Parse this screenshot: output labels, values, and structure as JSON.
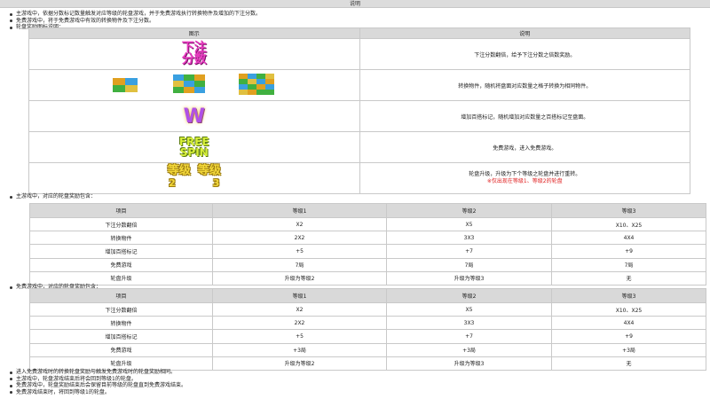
{
  "title": "说明",
  "intro": [
    "主游戏中，依据分数标记数量触发对应等级的轮盘游戏，并于免费游戏执行转换物件及增加的下注分数。",
    "免费游戏中，将于免费游戏中有效的转换物件及下注分数。",
    "轮盘奖励图标说明："
  ],
  "icon_table": {
    "headers": [
      "图示",
      "说明"
    ],
    "rows": [
      {
        "icon_text_1": "下注",
        "icon_text_2": "分数",
        "desc": "下注分数翻倍，给予下注分数之倍数奖励。"
      },
      {
        "desc": "转换物件，随机将盘面对应数量之格子转换为相同物件。"
      },
      {
        "icon_text_1": "W",
        "desc": "增加百搭标记，随机增加对应数量之百搭标记至盘面。"
      },
      {
        "icon_text_1": "FREE",
        "icon_text_2": "SPIN",
        "desc": "免费游戏，进入免费游戏。"
      },
      {
        "icon_text_1": "等级",
        "icon_text_2": "等级",
        "level_1": "2",
        "level_2": "3",
        "desc": "轮盘升级，升级为下个等级之轮盘并进行重转。",
        "desc_note": "※仅出现在等级1、等级2的轮盘"
      }
    ]
  },
  "main_label": "主游戏中，对应的轮盘奖励包含：",
  "main_table": {
    "headers": [
      "项目",
      "等级1",
      "等级2",
      "等级3"
    ],
    "rows": [
      [
        "下注分数翻倍",
        "X2",
        "X5",
        "X10、X25"
      ],
      [
        "转换物件",
        "2X2",
        "3X3",
        "4X4"
      ],
      [
        "增加百搭标记",
        "+5",
        "+7",
        "+9"
      ],
      [
        "免费游戏",
        "7局",
        "7局",
        "7局"
      ],
      [
        "轮盘升级",
        "升级为等级2",
        "升级为等级3",
        "无"
      ]
    ]
  },
  "free_label": "免费游戏中，对应的轮盘奖励包含：",
  "free_table": {
    "headers": [
      "项目",
      "等级1",
      "等级2",
      "等级3"
    ],
    "rows": [
      [
        "下注分数翻倍",
        "X2",
        "X5",
        "X10、X25"
      ],
      [
        "转换物件",
        "2X2",
        "3X3",
        "4X4"
      ],
      [
        "增加百搭标记",
        "+5",
        "+7",
        "+9"
      ],
      [
        "免费游戏",
        "+3局",
        "+3局",
        "+3局"
      ],
      [
        "轮盘升级",
        "升级为等级2",
        "升级为等级3",
        "无"
      ]
    ]
  },
  "footer": [
    "进入免费游戏时的转换轮盘奖励与触发免费游戏时的轮盘奖励相同。",
    "主游戏中，轮盘游戏结束后将会回到等级1的轮盘。",
    "免费游戏中，轮盘奖励结束后会保留目前等级的轮盘直到免费游戏结束。",
    "免费游戏结束时，将回到等级1的轮盘。"
  ],
  "colors": {
    "header_bg": "#d9d9d9",
    "title_bar_bg": "#dcdcdc",
    "note_red": "#e02020",
    "icon_gold": "#f3d83a",
    "icon_pink": "#e83ac0"
  },
  "icons": [
    "bet-multiplier-icon",
    "convert-symbols-icon",
    "wild-icon",
    "free-spin-icon",
    "level-up-icon"
  ]
}
